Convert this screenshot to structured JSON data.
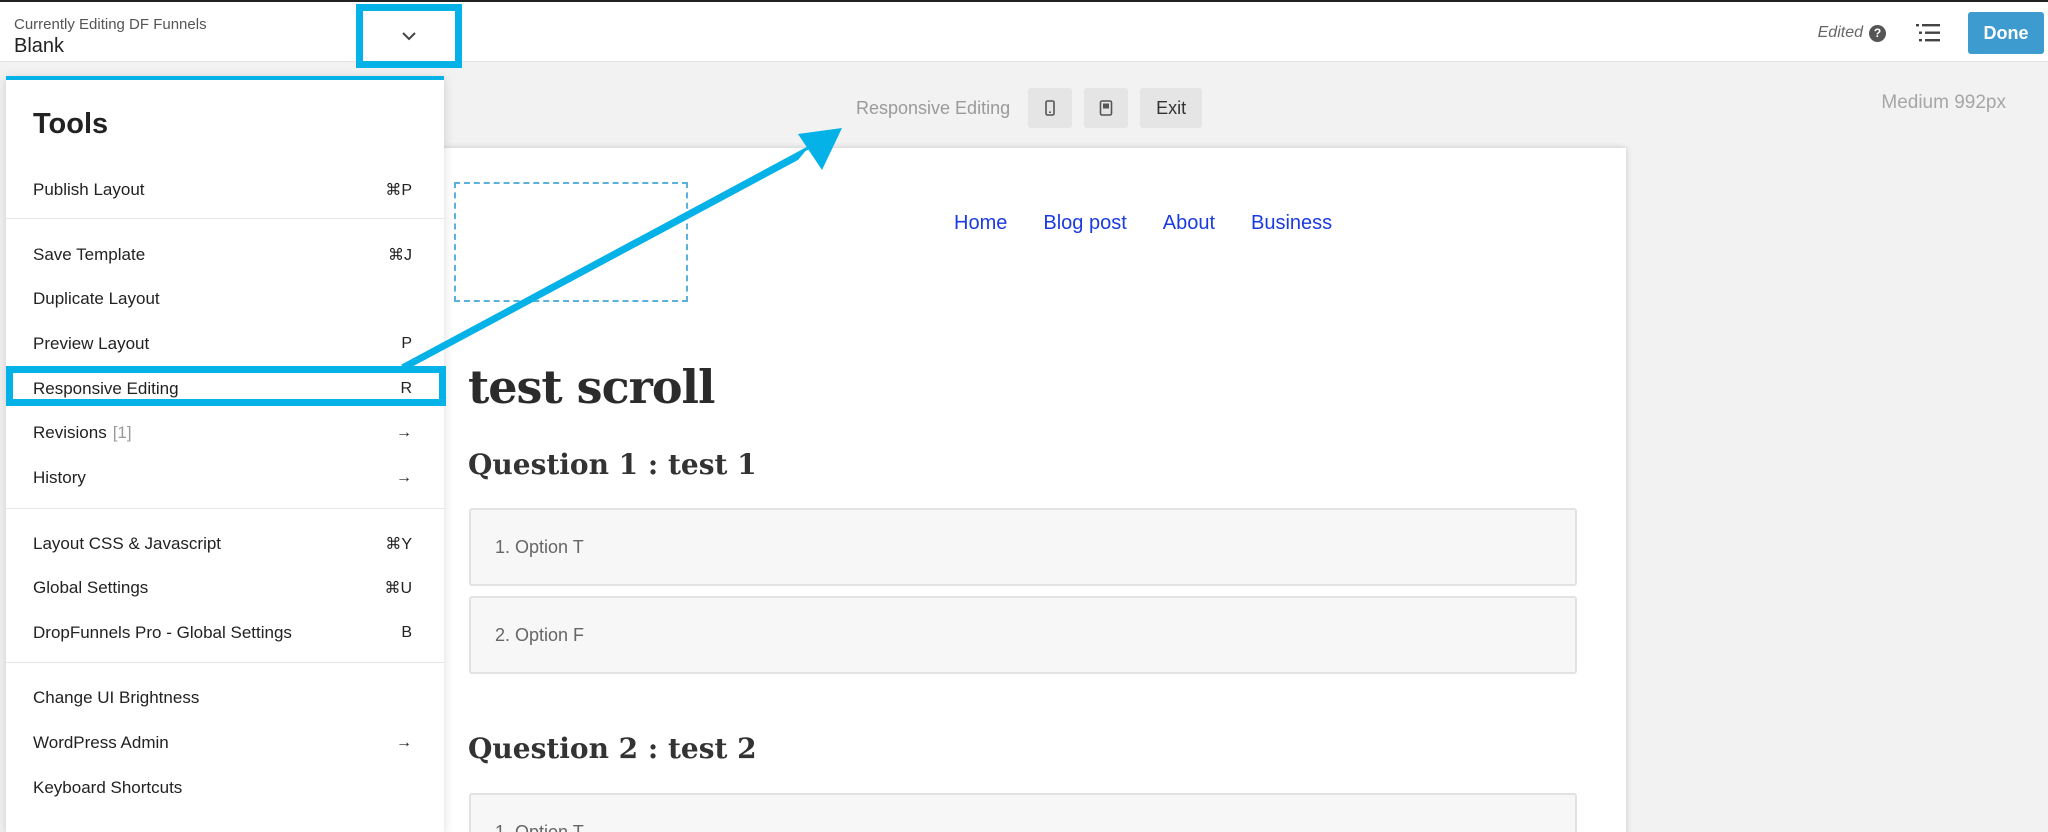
{
  "header": {
    "editing_label": "Currently Editing DF Funnels",
    "editing_title": "Blank",
    "status": "Edited",
    "done_label": "Done"
  },
  "responsive_bar": {
    "label": "Responsive Editing",
    "exit_label": "Exit",
    "breakpoint": "Medium 992px",
    "devices": [
      "phone-icon",
      "tablet-icon"
    ]
  },
  "tools_menu": {
    "title": "Tools",
    "items": [
      {
        "label": "Publish Layout",
        "shortcut": "⌘P"
      },
      {
        "label": "Save Template",
        "shortcut": "⌘J"
      },
      {
        "label": "Duplicate Layout",
        "shortcut": ""
      },
      {
        "label": "Preview Layout",
        "shortcut": "P"
      },
      {
        "label": "Responsive Editing",
        "shortcut": "R"
      },
      {
        "label": "Revisions",
        "count": "[1]",
        "shortcut": "→"
      },
      {
        "label": "History",
        "shortcut": "→"
      },
      {
        "label": "Layout CSS & Javascript",
        "shortcut": "⌘Y"
      },
      {
        "label": "Global Settings",
        "shortcut": "⌘U"
      },
      {
        "label": "DropFunnels Pro - Global Settings",
        "shortcut": "B"
      },
      {
        "label": "Change UI Brightness",
        "shortcut": ""
      },
      {
        "label": "WordPress Admin",
        "shortcut": "→"
      },
      {
        "label": "Keyboard Shortcuts",
        "shortcut": ""
      }
    ]
  },
  "page": {
    "nav": [
      "Home",
      "Blog post",
      "About",
      "Business"
    ],
    "title": "test scroll",
    "questions": [
      {
        "heading": "Question 1 : test 1",
        "options": [
          "1. Option T",
          "2. Option F"
        ]
      },
      {
        "heading": "Question 2 : test 2",
        "options": [
          "1. Option T"
        ]
      }
    ]
  },
  "colors": {
    "highlight": "#05b2e8",
    "done_button": "#3d9bd0",
    "nav_link": "#1a3be0"
  }
}
